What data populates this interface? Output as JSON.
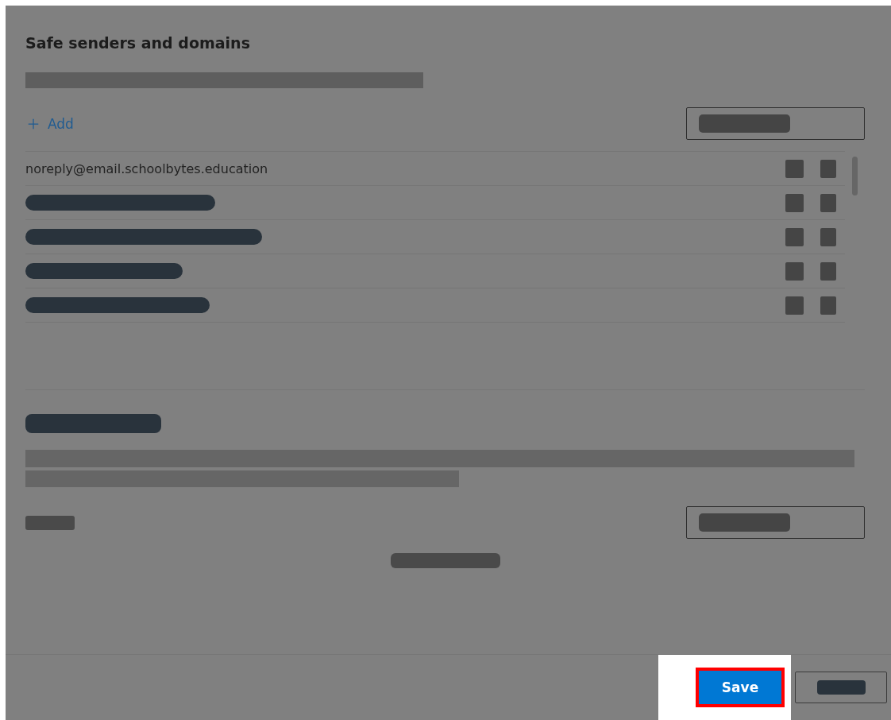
{
  "panel": {
    "title": "Safe senders and domains",
    "add_button": {
      "label": "Add"
    },
    "senders": [
      {
        "kind": "text",
        "address": "noreply@email.schoolbytes.education"
      },
      {
        "kind": "redacted"
      },
      {
        "kind": "redacted"
      },
      {
        "kind": "redacted"
      },
      {
        "kind": "redacted"
      }
    ],
    "save_button": {
      "label": "Save",
      "highlighted": true
    }
  }
}
